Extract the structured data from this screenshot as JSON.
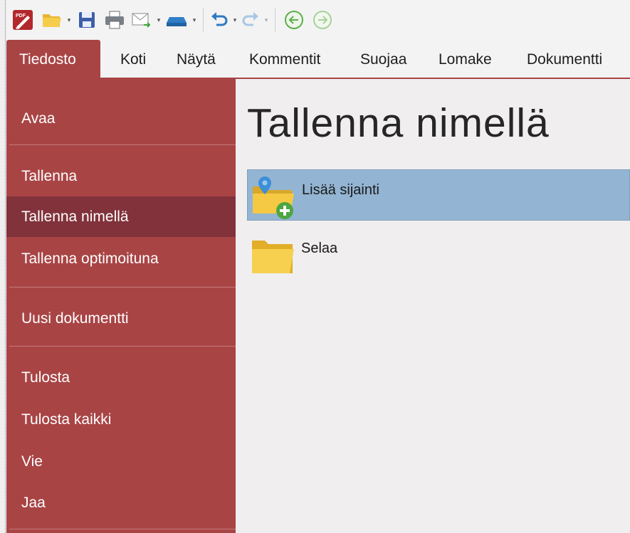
{
  "quick_access_toolbar": {
    "items": [
      {
        "name": "pdf-app-icon",
        "label": "PDF"
      },
      {
        "name": "open-folder-icon"
      },
      {
        "name": "save-icon"
      },
      {
        "name": "print-icon"
      },
      {
        "name": "email-icon"
      },
      {
        "name": "scan-icon"
      },
      {
        "name": "undo-icon"
      },
      {
        "name": "redo-icon"
      },
      {
        "name": "back-icon"
      },
      {
        "name": "forward-icon"
      }
    ]
  },
  "ribbon": {
    "tabs": [
      {
        "label": "Tiedosto",
        "active": true
      },
      {
        "label": "Koti"
      },
      {
        "label": "Näytä"
      },
      {
        "label": "Kommentit"
      },
      {
        "label": "Suojaa"
      },
      {
        "label": "Lomake"
      },
      {
        "label": "Dokumentti"
      }
    ]
  },
  "backstage": {
    "items": [
      {
        "label": "Avaa"
      },
      {
        "label": "Tallenna"
      },
      {
        "label": "Tallenna nimellä",
        "selected": true
      },
      {
        "label": "Tallenna optimoituna"
      },
      {
        "label": "Uusi dokumentti"
      },
      {
        "label": "Tulosta"
      },
      {
        "label": "Tulosta kaikki"
      },
      {
        "label": "Vie"
      },
      {
        "label": "Jaa"
      }
    ]
  },
  "main": {
    "title": "Tallenna nimellä",
    "locations": [
      {
        "label": "Lisää sijainti",
        "icon": "add-location-folder-icon",
        "selected": true
      },
      {
        "label": "Selaa",
        "icon": "browse-folder-icon"
      }
    ]
  },
  "colors": {
    "accent": "#a94445",
    "accent_selected": "#81323a",
    "location_selected": "#93b4d2",
    "background": "#f0eeee",
    "toolbar_bg": "#f3f3f3"
  }
}
